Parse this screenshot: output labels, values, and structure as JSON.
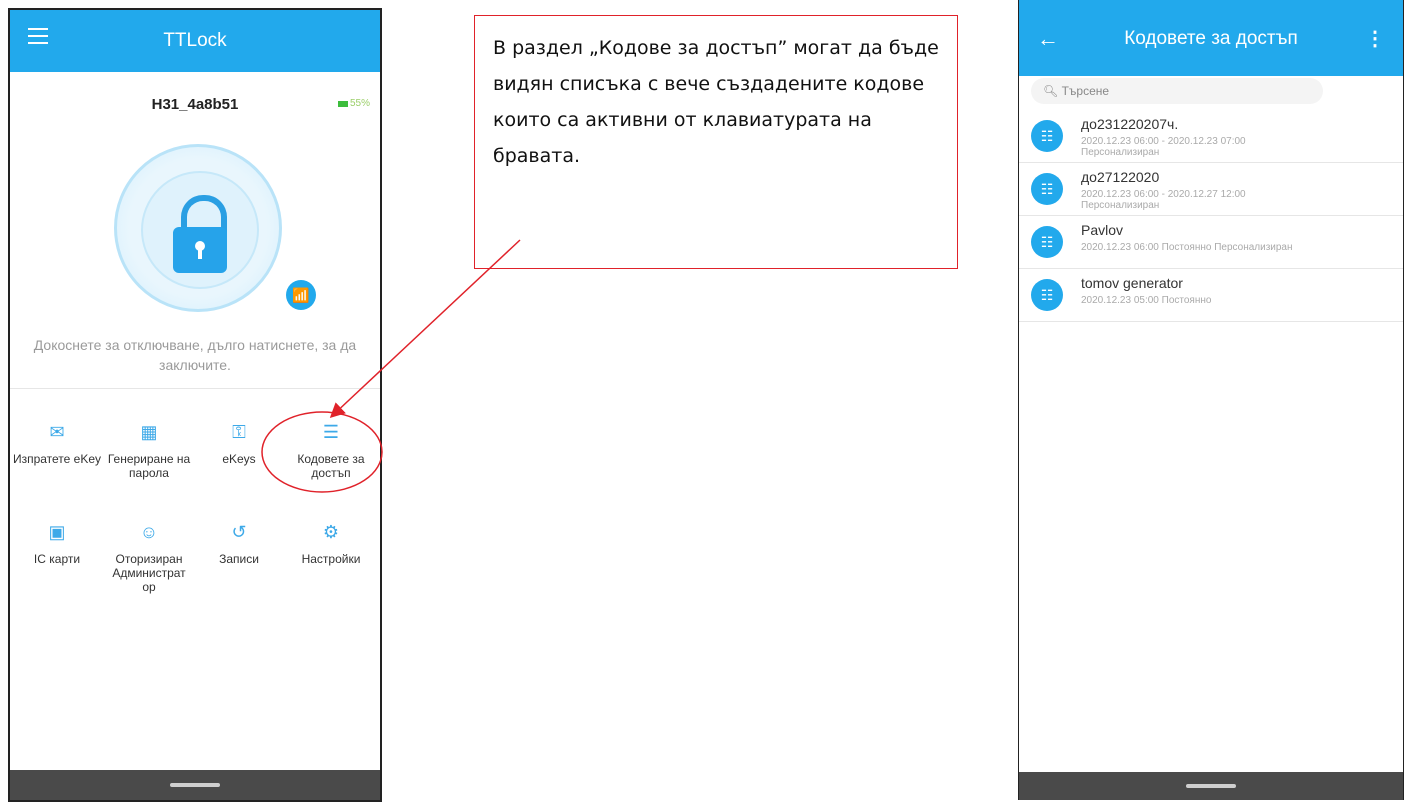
{
  "left_phone": {
    "app_title": "TTLock",
    "lock_name": "H31_4a8b51",
    "battery": "55%",
    "hint": "Докоснете за отключване, дълго натиснете, за да заключите.",
    "grid": [
      {
        "icon": "send-ekey-icon",
        "label": "Изпратете eKey"
      },
      {
        "icon": "generate-password-icon",
        "label": "Генериране на парола"
      },
      {
        "icon": "ekeys-icon",
        "label": "eKeys"
      },
      {
        "icon": "passcodes-icon",
        "label": "Кодовете за достъп"
      },
      {
        "icon": "ic-card-icon",
        "label": "IC карти"
      },
      {
        "icon": "admin-icon",
        "label": "Оторизиран Администрат ор"
      },
      {
        "icon": "records-icon",
        "label": "Записи"
      },
      {
        "icon": "settings-icon",
        "label": "Настройки"
      }
    ]
  },
  "callout": {
    "text": "В раздел „Кодове за достъп” могат да бъде видян списъка с вече създадените кодове които са активни от клавиатурата на бравата."
  },
  "right_phone": {
    "title": "Кодовете за достъп",
    "search_placeholder": "Търсене",
    "codes": [
      {
        "name": "до231220207ч.",
        "line1": "2020.12.23 06:00 - 2020.12.23 07:00",
        "line2": "Персонализиран"
      },
      {
        "name": "до27122020",
        "line1": "2020.12.23 06:00 - 2020.12.27 12:00",
        "line2": "Персонализиран"
      },
      {
        "name": "Pavlov",
        "line1": "2020.12.23 06:00   Постоянно   Персонализиран",
        "line2": ""
      },
      {
        "name": "tomov generator",
        "line1": "2020.12.23 05:00   Постоянно",
        "line2": ""
      }
    ]
  },
  "colors": {
    "accent": "#22a9ec",
    "highlight": "#e0222a"
  }
}
